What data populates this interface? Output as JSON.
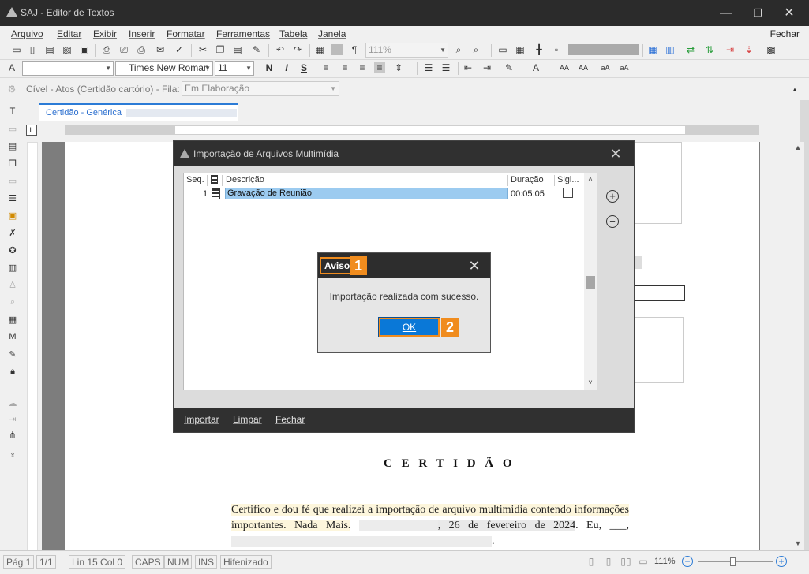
{
  "window": {
    "title": "SAJ - Editor de Textos",
    "minimize": "—",
    "restore": "❐",
    "close": "✕"
  },
  "menu": {
    "items": [
      "Arquivo",
      "Editar",
      "Exibir",
      "Inserir",
      "Formatar",
      "Ferramentas",
      "Tabela",
      "Janela"
    ],
    "right": "Fechar"
  },
  "toolbar": {
    "zoom_value": "111%",
    "font_name": "Times New Roman",
    "font_size": "11",
    "bold": "N",
    "italic": "I",
    "strike": "S"
  },
  "context": {
    "label": "Cível - Atos (Certidão cartório) - Fila:",
    "queue_value": "Em Elaboração"
  },
  "document_tab": {
    "label": "Certidão - Genérica"
  },
  "document": {
    "title": "C E R T I D Ã O",
    "para_part1": "Certifico e dou fé que realizei a importação de arquivo multimidia contendo informações importantes. Nada Mais.",
    "para_part2": ", 26 de fevereiro de 2024",
    "para_part3": ". Eu, ___,",
    "para_end": "."
  },
  "import_dialog": {
    "title": "Importação de Arquivos Multimídia",
    "columns": {
      "seq": "Seq.",
      "description": "Descrição",
      "duration": "Duração",
      "sigiloso": "Sigi..."
    },
    "rows": [
      {
        "seq": "1",
        "description": "Gravação de Reunião",
        "duration": "00:05:05",
        "sigiloso": false
      }
    ],
    "buttons": {
      "importar": "Importar",
      "limpar": "Limpar",
      "fechar": "Fechar"
    }
  },
  "aviso_dialog": {
    "title": "Aviso",
    "badge1": "1",
    "message": "Importação realizada com sucesso.",
    "ok": "OK",
    "badge2": "2"
  },
  "statusbar": {
    "page": "Pág 1",
    "pages": "1/1",
    "line_col": "Lin 15  Col 0",
    "caps": "CAPS",
    "num": "NUM",
    "ins": "INS",
    "hyphen": "Hifenizado",
    "zoom": "111%"
  },
  "colors": {
    "accent": "#0a78d7",
    "highlight_orange": "#f08c1e",
    "dark_title": "#2b2b2b"
  }
}
